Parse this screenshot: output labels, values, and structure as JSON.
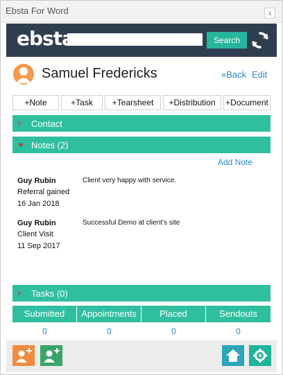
{
  "window": {
    "title": "Ebsta For Word",
    "close_glyph": "x"
  },
  "header": {
    "logo": "ebsta",
    "search": {
      "value": "",
      "placeholder": ""
    },
    "search_button_label": "Search",
    "colors": {
      "header_bg": "#2f3e4f",
      "accent": "#26b59d"
    },
    "icons": {
      "refresh": "refresh-icon"
    }
  },
  "profile": {
    "name": "Samuel Fredericks",
    "back_label": "«Back",
    "edit_label": "Edit",
    "avatar_icon": "person-icon"
  },
  "actions": [
    {
      "label": "+Note"
    },
    {
      "label": "+Task"
    },
    {
      "label": "+Tearsheet"
    },
    {
      "label": "+Distribution"
    },
    {
      "label": "+Document"
    }
  ],
  "sections": {
    "contact": {
      "label": "Contact",
      "expanded": false
    },
    "notes": {
      "label": "Notes (2)",
      "expanded": true
    },
    "tasks": {
      "label": "Tasks (0)",
      "expanded": false
    }
  },
  "notes": {
    "add_label": "Add Note",
    "items": [
      {
        "author": "Guy Rubin",
        "reason": "Referral gained",
        "date": "16 Jan 2018",
        "text": "Client very happy with service."
      },
      {
        "author": "Guy Rubin",
        "reason": "Client Visit",
        "date": "11 Sep 2017",
        "text": "Successful Demo at client's site"
      }
    ]
  },
  "stats": [
    {
      "label": "Submitted",
      "value": "0"
    },
    {
      "label": "Appointments",
      "value": "0"
    },
    {
      "label": "Placed",
      "value": "0"
    },
    {
      "label": "Sendouts",
      "value": "0"
    }
  ],
  "footer": {
    "icons": [
      "add-contact-icon",
      "add-candidate-icon",
      "home-icon",
      "settings-icon"
    ],
    "colors": {
      "orange": "#f28c3e",
      "green": "#3aa56a",
      "teal": "#2aa7b8",
      "settings": "#1fb59a"
    }
  }
}
